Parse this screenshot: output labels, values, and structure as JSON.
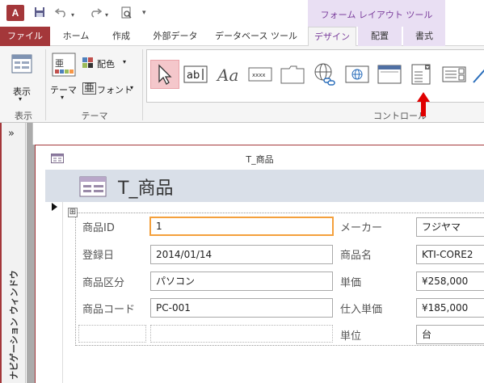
{
  "titlebar": {
    "app_icon_label": "A",
    "qa_items": [
      "save-icon",
      "undo-icon",
      "redo-icon",
      "print-preview-icon",
      "customize-icon"
    ],
    "context_tab_title": "フォーム レイアウト ツール"
  },
  "tabs": {
    "file": "ファイル",
    "home": "ホーム",
    "create": "作成",
    "external": "外部データ",
    "dbtools": "データベース ツール",
    "design": "デザイン",
    "arrange": "配置",
    "format": "書式"
  },
  "ribbon": {
    "views": {
      "button": "表示",
      "group": "表示"
    },
    "themes": {
      "themes_button": "テーマ",
      "colors": "配色",
      "fonts": "フォント",
      "group": "テーマ"
    },
    "controls": {
      "group": "コントロール",
      "items": [
        "select",
        "textbox",
        "label",
        "button",
        "tab-control",
        "hyperlink",
        "web-browser",
        "navigation-control",
        "combo-box",
        "option-group"
      ]
    }
  },
  "nav": {
    "chevron": "»",
    "label": "ナビゲーション ウィンドウ"
  },
  "form": {
    "window_title": "T_商品",
    "header_title": "T_商品",
    "move_handle": "⊞",
    "rows": [
      {
        "label1": "商品ID",
        "value1": "1",
        "label2": "メーカー",
        "value2": "フジヤマ"
      },
      {
        "label1": "登録日",
        "value1": "2014/01/14",
        "label2": "商品名",
        "value2": "KTI-CORE2"
      },
      {
        "label1": "商品区分",
        "value1": "パソコン",
        "label2": "単価",
        "value2": "¥258,000"
      },
      {
        "label1": "商品コード",
        "value1": "PC-001",
        "label2": "仕入単価",
        "value2": "¥185,000"
      },
      {
        "label1": "",
        "value1": "",
        "label2": "単位",
        "value2": "台"
      }
    ]
  },
  "colors": {
    "access_red": "#a4373a",
    "context_purple": "#7a3d9c",
    "focus_orange": "#f4a03c",
    "arrow_red": "#e00000"
  }
}
